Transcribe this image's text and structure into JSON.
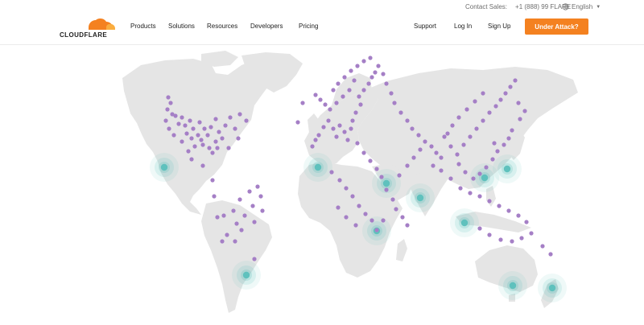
{
  "header": {
    "contact_label": "Contact Sales:",
    "contact_phone": "+1 (888) 99 FLARE",
    "language": "English"
  },
  "brand": {
    "name": "CLOUDFLARE",
    "logo_icon": "cloud-icon",
    "colors": {
      "orange": "#f48120",
      "light_orange": "#faad3f"
    }
  },
  "nav": {
    "left": [
      "Products",
      "Solutions",
      "Resources",
      "Developers",
      "Pricing"
    ],
    "right": [
      "Support",
      "Log In",
      "Sign Up"
    ],
    "cta": "Under Attack?"
  },
  "map": {
    "land_color": "#e5e5e5",
    "pop_color": "#a57fc6",
    "hub_color": "#5fc1bd"
  }
}
